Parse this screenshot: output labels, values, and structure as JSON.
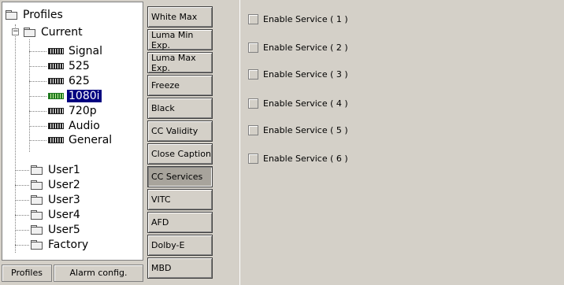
{
  "tree": {
    "root": "Profiles",
    "current": "Current",
    "formats": [
      "Signal",
      "525",
      "625",
      "1080i",
      "720p",
      "Audio",
      "General"
    ],
    "selected": "1080i",
    "users": [
      "User1",
      "User2",
      "User3",
      "User4",
      "User5",
      "Factory"
    ],
    "expander": "−"
  },
  "bottom_tabs": {
    "profiles": "Profiles",
    "alarm": "Alarm config."
  },
  "nav_buttons": [
    "White Max",
    "Luma Min Exp.",
    "Luma Max Exp.",
    "Freeze",
    "Black",
    "CC Validity",
    "Close Caption",
    "CC Services",
    "VITC",
    "AFD",
    "Dolby-E",
    "MBD"
  ],
  "active_nav": "CC Services",
  "services": [
    "Enable Service ( 1 )",
    "Enable Service ( 2 )",
    "Enable Service ( 3 )",
    "Enable Service ( 4 )",
    "Enable Service ( 5 )",
    "Enable Service ( 6 )"
  ]
}
